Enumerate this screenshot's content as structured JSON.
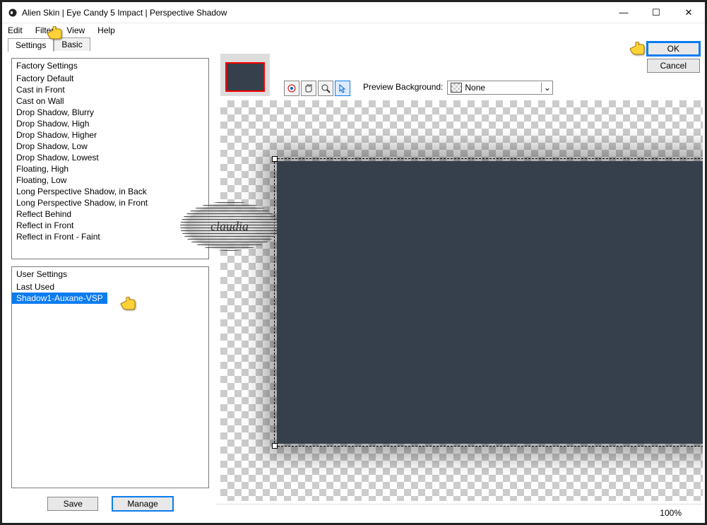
{
  "window": {
    "title": "Alien Skin | Eye Candy 5 Impact | Perspective Shadow"
  },
  "menubar": {
    "edit": "Edit",
    "filter": "Filter",
    "view": "View",
    "help": "Help"
  },
  "tabs": {
    "settings": "Settings",
    "basic": "Basic"
  },
  "factory": {
    "header": "Factory Settings",
    "items": [
      "Factory Default",
      "Cast in Front",
      "Cast on Wall",
      "Drop Shadow, Blurry",
      "Drop Shadow, High",
      "Drop Shadow, Higher",
      "Drop Shadow, Low",
      "Drop Shadow, Lowest",
      "Floating, High",
      "Floating, Low",
      "Long Perspective Shadow, in Back",
      "Long Perspective Shadow, in Front",
      "Reflect Behind",
      "Reflect in Front",
      "Reflect in Front - Faint"
    ]
  },
  "user": {
    "header": "User Settings",
    "items": [
      {
        "label": "Last Used",
        "selected": false
      },
      {
        "label": "Shadow1-Auxane-VSP",
        "selected": true
      }
    ]
  },
  "buttons": {
    "save": "Save",
    "manage": "Manage",
    "ok": "OK",
    "cancel": "Cancel"
  },
  "preview": {
    "bg_label": "Preview Background:",
    "bg_value": "None"
  },
  "status": {
    "zoom": "100%"
  },
  "watermark": "claudia"
}
